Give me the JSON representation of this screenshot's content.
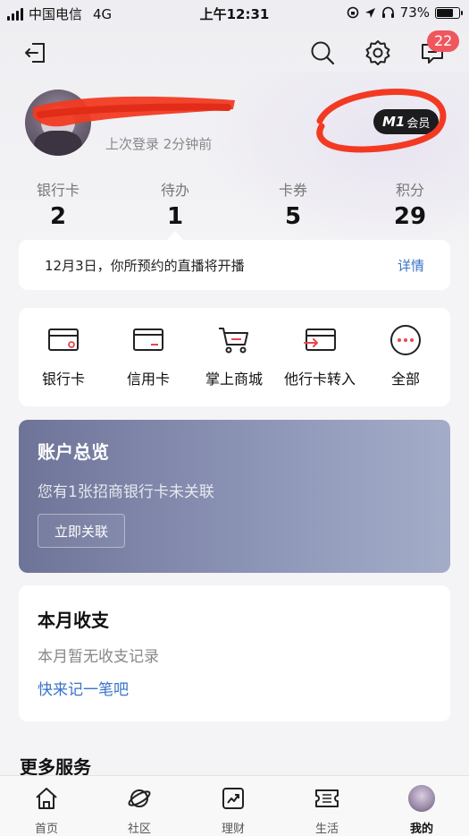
{
  "status_bar": {
    "carrier": "中国电信",
    "network": "4G",
    "time": "上午12:31",
    "battery_text": "73%",
    "battery_level": 0.73
  },
  "header": {
    "message_badge": "22",
    "icons": [
      "logout-icon",
      "search-icon",
      "settings-icon",
      "message-icon"
    ]
  },
  "profile": {
    "last_login": "上次登录 2分钟前",
    "member_level": "M1",
    "member_suffix": "会员"
  },
  "stats": [
    {
      "label": "银行卡",
      "value": "2"
    },
    {
      "label": "待办",
      "value": "1"
    },
    {
      "label": "卡券",
      "value": "5"
    },
    {
      "label": "积分",
      "value": "29"
    }
  ],
  "notice": {
    "text": "12月3日，你所预约的直播将开播",
    "link": "详情"
  },
  "shortcuts": [
    {
      "label": "银行卡",
      "icon": "bank-card-icon"
    },
    {
      "label": "信用卡",
      "icon": "credit-card-icon"
    },
    {
      "label": "掌上商城",
      "icon": "shopping-cart-icon"
    },
    {
      "label": "他行卡转入",
      "icon": "transfer-in-icon"
    },
    {
      "label": "全部",
      "icon": "more-icon"
    }
  ],
  "overview": {
    "title": "账户总览",
    "subtitle": "您有1张招商银行卡未关联",
    "button": "立即关联"
  },
  "monthly": {
    "title": "本月收支",
    "empty_text": "本月暂无收支记录",
    "link": "快来记一笔吧"
  },
  "more_services_title": "更多服务",
  "tabbar": {
    "items": [
      {
        "label": "首页",
        "icon": "home-icon"
      },
      {
        "label": "社区",
        "icon": "planet-icon"
      },
      {
        "label": "理财",
        "icon": "chart-icon"
      },
      {
        "label": "生活",
        "icon": "ticket-icon"
      },
      {
        "label": "我的",
        "icon": "avatar-icon"
      }
    ],
    "active_index": 4
  },
  "colors": {
    "accent_blue": "#3a73c8",
    "badge_red": "#f0565d",
    "overview_gradient_start": "#6e7498",
    "overview_gradient_end": "#a3adc8"
  }
}
